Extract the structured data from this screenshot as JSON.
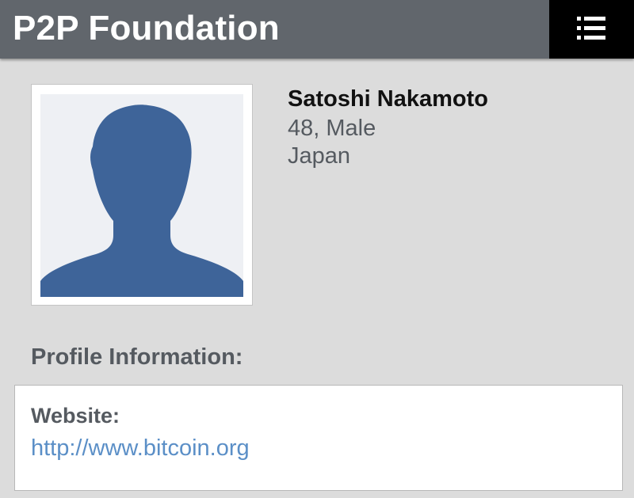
{
  "header": {
    "site_title": "P2P Foundation",
    "menu_icon": "list-menu-icon",
    "background_color": "#61666c",
    "menu_button_color": "#000000"
  },
  "profile": {
    "avatar_icon": "default-user-silhouette-icon",
    "avatar_color": "#3e6499",
    "name": "Satoshi Nakamoto",
    "age_gender": "48, Male",
    "location": "Japan"
  },
  "profile_information": {
    "heading": "Profile Information:",
    "website_label": "Website:",
    "website_url": "http://www.bitcoin.org",
    "link_color": "#5b8fc7"
  }
}
